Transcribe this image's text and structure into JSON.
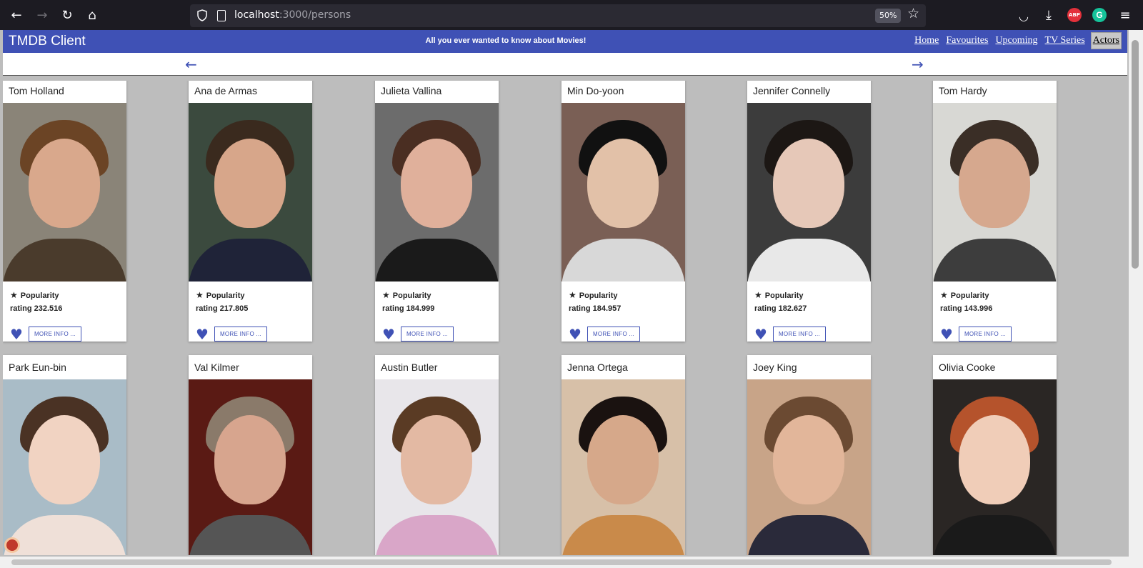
{
  "browser": {
    "url_host": "localhost",
    "url_path": ":3000/persons",
    "zoom": "50%",
    "back_icon": "←",
    "forward_icon": "→",
    "reload_icon": "↻",
    "home_icon": "⌂",
    "star_icon": "☆",
    "abp_label": "ABP",
    "grammarly_label": "G",
    "menu_icon": "≡",
    "pocket_icon": "◡",
    "download_icon": "⤓"
  },
  "app": {
    "title": "TMDB Client",
    "tagline": "All you ever wanted to know about Movies!",
    "nav": [
      "Home",
      "Favourites",
      "Upcoming",
      "TV Series",
      "Actors"
    ],
    "active_nav": "Actors",
    "brand_color": "#3f51b5"
  },
  "pager": {
    "prev_icon": "←",
    "next_icon": "→"
  },
  "card_labels": {
    "popularity": "Popularity",
    "rating_prefix": "rating",
    "more_info": "MORE INFO ...",
    "star_icon": "★",
    "heart_icon": "♥"
  },
  "persons": [
    {
      "name": "Tom Holland",
      "rating": "rating 232.516",
      "popularity": "Popularity",
      "more": "MORE INFO ...",
      "bg": "#8a8478",
      "skin": "#d9a88c",
      "hair": "#6b4425",
      "cloth": "#4a3b2c"
    },
    {
      "name": "Ana de Armas",
      "rating": "rating 217.805",
      "popularity": "Popularity",
      "more": "MORE INFO ...",
      "bg": "#3b4a3e",
      "skin": "#d7a68a",
      "hair": "#3a2a1e",
      "cloth": "#1f2338"
    },
    {
      "name": "Julieta Vallina",
      "rating": "rating 184.999",
      "popularity": "Popularity",
      "more": "MORE INFO ...",
      "bg": "#6c6c6c",
      "skin": "#e0b09b",
      "hair": "#4a2e22",
      "cloth": "#1a1a1a"
    },
    {
      "name": "Min Do-yoon",
      "rating": "rating 184.957",
      "popularity": "Popularity",
      "more": "MORE INFO ...",
      "bg": "#7a5f55",
      "skin": "#e2c1a8",
      "hair": "#111111",
      "cloth": "#d8d8d8"
    },
    {
      "name": "Jennifer Connelly",
      "rating": "rating 182.627",
      "popularity": "Popularity",
      "more": "MORE INFO ...",
      "bg": "#3c3c3c",
      "skin": "#e6c8b8",
      "hair": "#1c1714",
      "cloth": "#e8e8e8"
    },
    {
      "name": "Tom Hardy",
      "rating": "rating 143.996",
      "popularity": "Popularity",
      "more": "MORE INFO ...",
      "bg": "#d8d8d4",
      "skin": "#d6a88e",
      "hair": "#3a2e26",
      "cloth": "#3d3d3d"
    },
    {
      "name": "Park Eun-bin",
      "rating": "",
      "popularity": "",
      "more": "",
      "bg": "#a9bcc7",
      "skin": "#f1d3c2",
      "hair": "#4a3224",
      "cloth": "#efe0d8"
    },
    {
      "name": "Val Kilmer",
      "rating": "",
      "popularity": "",
      "more": "",
      "bg": "#5a1a14",
      "skin": "#d7a58e",
      "hair": "#8a7a6a",
      "cloth": "#555555"
    },
    {
      "name": "Austin Butler",
      "rating": "",
      "popularity": "",
      "more": "",
      "bg": "#e8e6ea",
      "skin": "#e3b9a3",
      "hair": "#5a3b24",
      "cloth": "#d9a6c8"
    },
    {
      "name": "Jenna Ortega",
      "rating": "",
      "popularity": "",
      "more": "",
      "bg": "#d7c0a8",
      "skin": "#d6a88a",
      "hair": "#1a1210",
      "cloth": "#c98a4a"
    },
    {
      "name": "Joey King",
      "rating": "",
      "popularity": "",
      "more": "",
      "bg": "#c8a488",
      "skin": "#e2b69a",
      "hair": "#6b4a32",
      "cloth": "#2a2a3a"
    },
    {
      "name": "Olivia Cooke",
      "rating": "",
      "popularity": "",
      "more": "",
      "bg": "#2a2624",
      "skin": "#f0cdb8",
      "hair": "#b5532c",
      "cloth": "#1a1a1a"
    }
  ]
}
